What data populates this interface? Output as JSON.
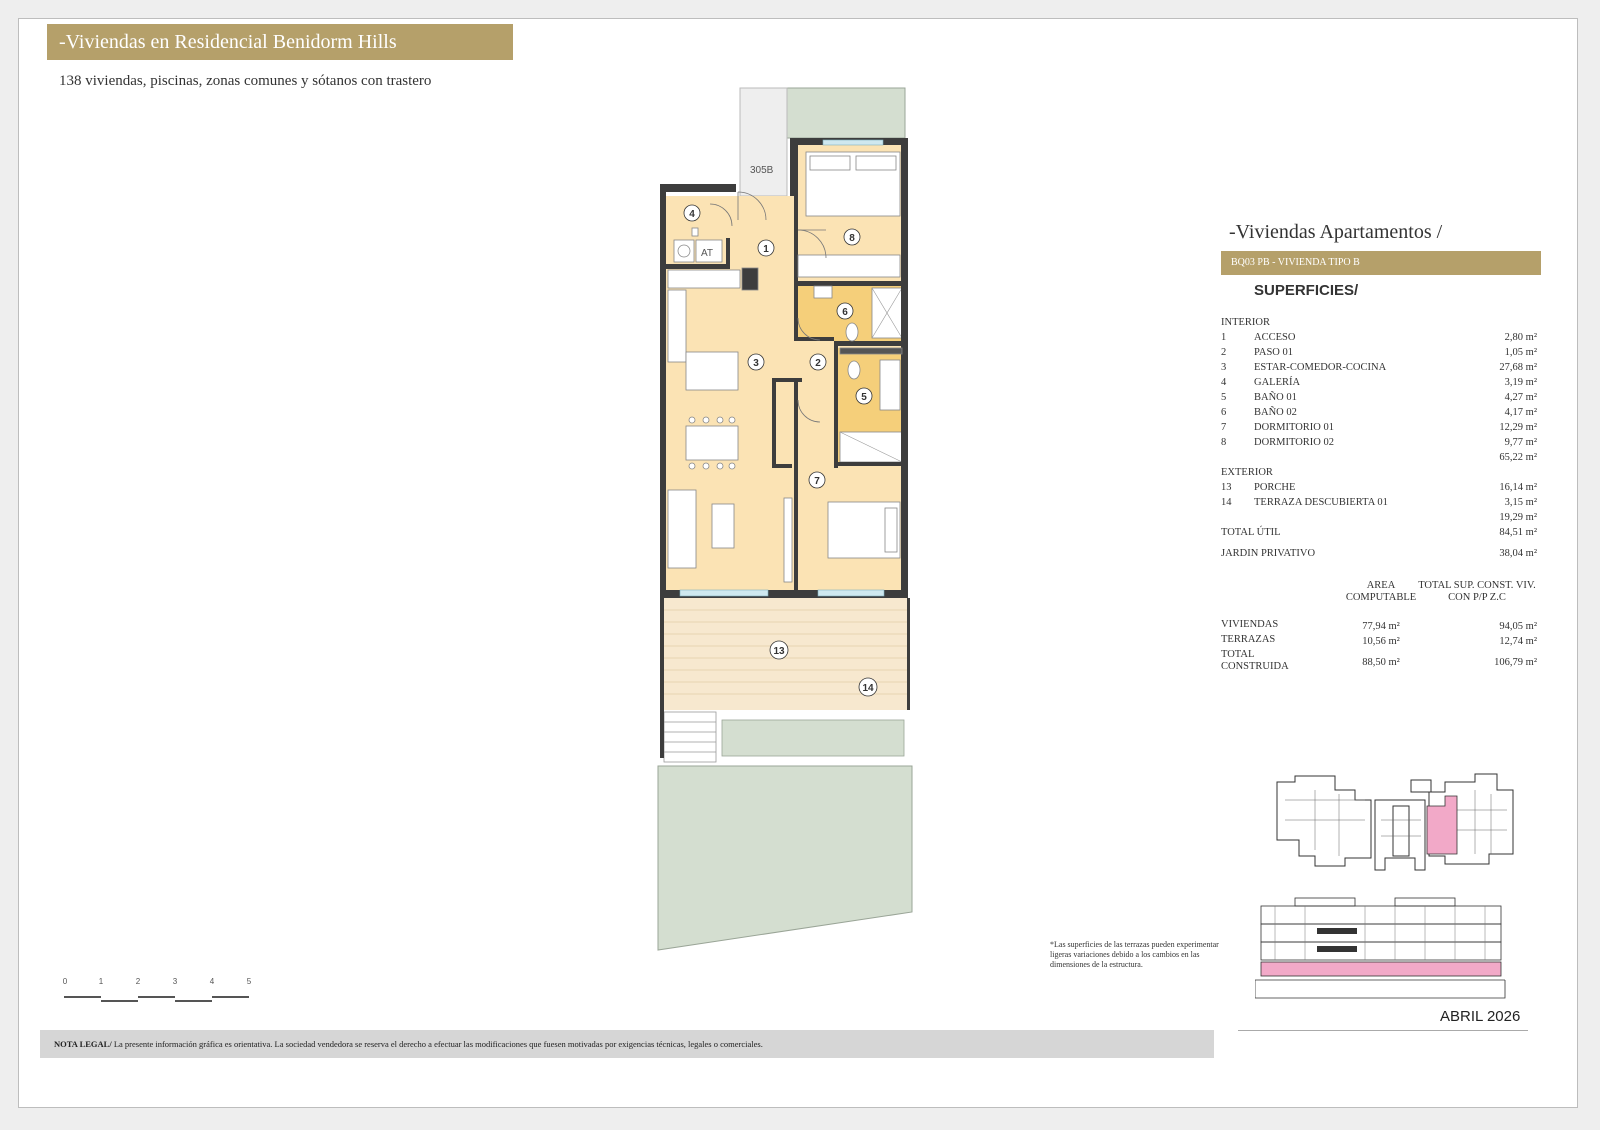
{
  "header": {
    "title": "-Viviendas en Residencial Benidorm Hills",
    "subtitle": "138 viviendas, piscinas, zonas comunes y sótanos con trastero"
  },
  "plan": {
    "unit_code": "305B",
    "room_labels": [
      "1",
      "2",
      "3",
      "4",
      "5",
      "6",
      "7",
      "8",
      "13",
      "14"
    ],
    "wall_color": "#3d3d3d",
    "interior_color": "#fbe3b4",
    "bath_color": "#f5cf7a",
    "terrace_color": "#f7e8cf",
    "garden_color": "#d4ded0",
    "appliance_label": "AT"
  },
  "panel": {
    "title": "-Viviendas Apartamentos /",
    "banner": "BQ03 PB - VIVIENDA TIPO B",
    "heading": "SUPERFICIES/",
    "interior_label": "INTERIOR",
    "interior": [
      {
        "num": "1",
        "name": "ACCESO",
        "area": "2,80 m²"
      },
      {
        "num": "2",
        "name": "PASO 01",
        "area": "1,05 m²"
      },
      {
        "num": "3",
        "name": "ESTAR-COMEDOR-COCINA",
        "area": "27,68 m²"
      },
      {
        "num": "4",
        "name": "GALERÍA",
        "area": "3,19 m²"
      },
      {
        "num": "5",
        "name": "BAÑO 01",
        "area": "4,27 m²"
      },
      {
        "num": "6",
        "name": "BAÑO 02",
        "area": "4,17 m²"
      },
      {
        "num": "7",
        "name": "DORMITORIO 01",
        "area": "12,29 m²"
      },
      {
        "num": "8",
        "name": "DORMITORIO 02",
        "area": "9,77 m²"
      }
    ],
    "interior_subtotal": "65,22 m²",
    "exterior_label": "EXTERIOR",
    "exterior": [
      {
        "num": "13",
        "name": "PORCHE",
        "area": "16,14 m²"
      },
      {
        "num": "14",
        "name": "TERRAZA DESCUBIERTA 01",
        "area": "3,15 m²"
      }
    ],
    "exterior_subtotal": "19,29 m²",
    "total_util_label": "TOTAL ÚTIL",
    "total_util": "84,51 m²",
    "jardin_label": "JARDIN PRIVATIVO",
    "jardin": "38,04 m²",
    "col_area": "AREA COMPUTABLE",
    "col_total": "TOTAL SUP. CONST. VIV. CON P/P Z.C",
    "summary": [
      {
        "label": "VIVIENDAS",
        "area": "77,94 m²",
        "total": "94,05 m²"
      },
      {
        "label": "TERRAZAS",
        "area": "10,56 m²",
        "total": "12,74 m²"
      },
      {
        "label": "TOTAL CONSTRUIDA",
        "area": "88,50 m²",
        "total": "106,79 m²"
      }
    ]
  },
  "highlight_color": "#f2a9c8",
  "scale_labels": [
    "0",
    "1",
    "2",
    "3",
    "4",
    "5"
  ],
  "footnote": "*Las superficies de las terrazas pueden experimentar ligeras variaciones debido a los cambios en las dimensiones de la estructura.",
  "date": "ABRIL 2026",
  "legal": {
    "label": "NOTA LEGAL/",
    "text": " La presente información gráfica es orientativa. La sociedad vendedora se reserva el derecho a efectuar las modificaciones que fuesen motivadas por exigencias técnicas, legales o comerciales."
  }
}
